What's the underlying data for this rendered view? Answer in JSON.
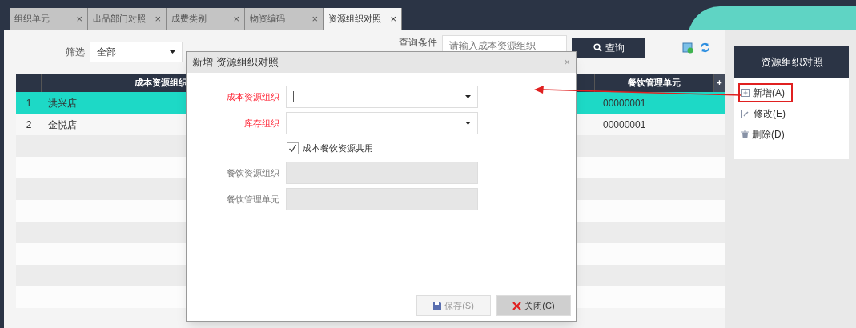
{
  "tabs": [
    {
      "label": "组织单元",
      "close": "×",
      "selected": false
    },
    {
      "label": "出品部门对照",
      "close": "×",
      "selected": false
    },
    {
      "label": "成费类别",
      "close": "×",
      "selected": false
    },
    {
      "label": "物资编码",
      "close": "×",
      "selected": false
    },
    {
      "label": "资源组织对照",
      "close": "×",
      "selected": true
    }
  ],
  "filter": {
    "label": "筛选",
    "value": "全部"
  },
  "query": {
    "label": "查询条件",
    "placeholder": "请输入成本资源组织",
    "button": "查询"
  },
  "table": {
    "columns": [
      "",
      "成本资源组织",
      "",
      "餐饮管理单元"
    ],
    "add_column": "+",
    "rows": [
      {
        "cells": [
          "1",
          "洪兴店",
          "",
          "00000001"
        ],
        "selected": true
      },
      {
        "cells": [
          "2",
          "金悦店",
          "",
          "00000001"
        ],
        "selected": false
      }
    ]
  },
  "side_panel": {
    "title": "资源组织对照",
    "actions": [
      {
        "kind": "add",
        "label": "新增(A)",
        "highlighted": true
      },
      {
        "kind": "edit",
        "label": "修改(E)",
        "highlighted": false
      },
      {
        "kind": "delete",
        "label": "删除(D)",
        "highlighted": false
      }
    ]
  },
  "dialog": {
    "title": "新增 资源组织对照",
    "close": "×",
    "fields": [
      {
        "kind": "select",
        "label": "成本资源组织",
        "required": true,
        "focused": true,
        "disabled": false
      },
      {
        "kind": "select",
        "label": "库存组织",
        "required": true,
        "focused": false,
        "disabled": false
      },
      {
        "kind": "checkbox",
        "label": "成本餐饮资源共用",
        "checked": true
      },
      {
        "kind": "text",
        "label": "餐饮资源组织",
        "required": false,
        "disabled": true
      },
      {
        "kind": "text",
        "label": "餐饮管理单元",
        "required": false,
        "disabled": true
      }
    ],
    "buttons": [
      {
        "kind": "save",
        "label": "保存(S)",
        "disabled": true
      },
      {
        "kind": "close",
        "label": "关闭(C)",
        "disabled": false
      }
    ]
  }
}
